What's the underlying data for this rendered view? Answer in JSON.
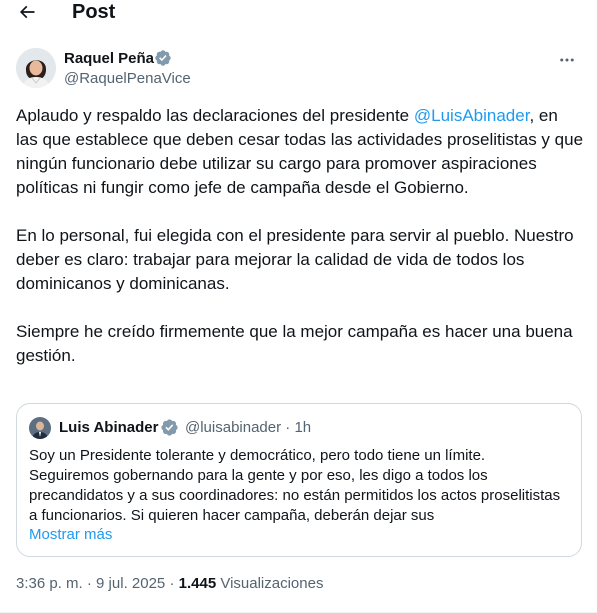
{
  "header": {
    "title": "Post",
    "back_icon": "arrow-left-icon"
  },
  "author": {
    "name": "Raquel Peña",
    "handle": "@RaquelPenaVice",
    "verified_icon": "verified-badge-icon",
    "more_icon": "more-horizontal-icon"
  },
  "post": {
    "p1_before": "Aplaudo y respaldo las declaraciones del presidente ",
    "p1_mention": "@LuisAbinader",
    "p1_after": ", en las que establece que deben cesar todas las actividades proselitistas y que ningún funcionario debe utilizar su cargo para promover aspiraciones políticas ni fungir como jefe de campaña desde el Gobierno.",
    "p2": "En lo personal, fui elegida con el presidente para servir al pueblo. Nuestro deber es claro: trabajar para mejorar la calidad de vida de todos los dominicanos y dominicanas.",
    "p3": "Siempre he creído firmemente que la mejor campaña es hacer una buena gestión."
  },
  "quote": {
    "name": "Luis Abinader",
    "handle_time": "@luisabinader · 1h",
    "text": "Soy un Presidente tolerante y democrático, pero todo tiene un límite. Seguiremos gobernando para la gente y por eso, les digo a todos los precandidatos y a sus coordinadores: no están permitidos los actos proselitistas a funcionarios. Si quieren hacer campaña, deberán dejar sus",
    "show_more": "Mostrar más"
  },
  "meta": {
    "time": "3:36 p. m.",
    "sep": " · ",
    "date": "9 jul. 2025",
    "views_count": "1.445",
    "views_label": "Visualizaciones"
  },
  "colors": {
    "accent": "#1d9bf0",
    "secondary_text": "#536471",
    "border": "#cfd9de"
  }
}
